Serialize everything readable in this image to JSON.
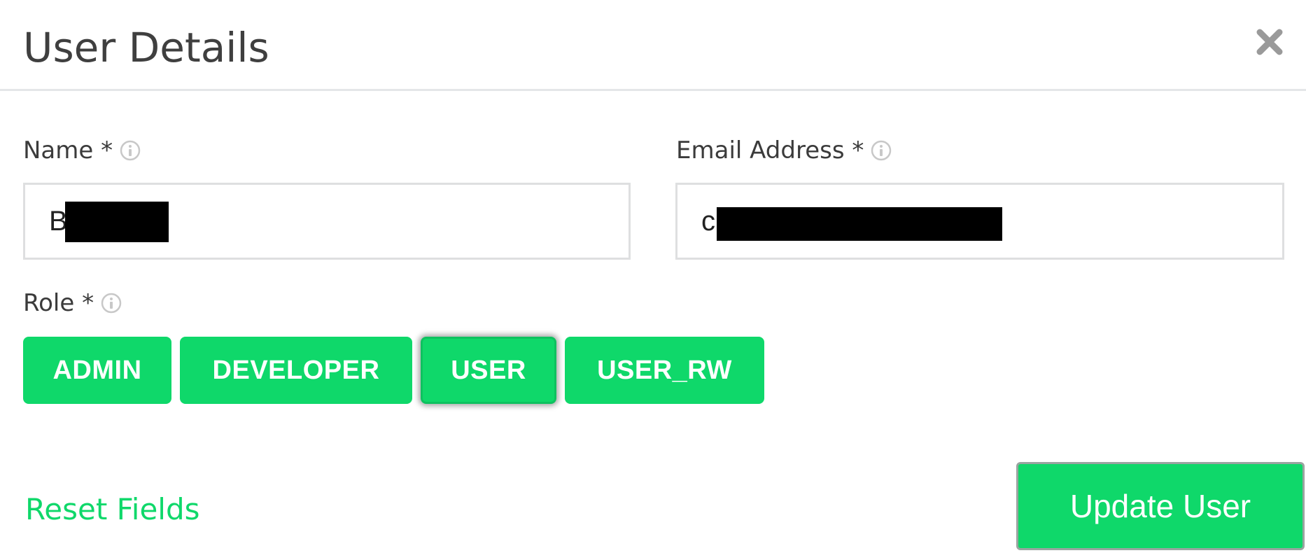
{
  "dialog": {
    "title": "User Details",
    "close_icon": "close-icon"
  },
  "form": {
    "name": {
      "label": "Name *",
      "value": "B          y",
      "info_icon": "info-icon"
    },
    "email": {
      "label": "Email Address *",
      "value": "c                              l",
      "info_icon": "info-icon"
    },
    "role": {
      "label": "Role *",
      "info_icon": "info-icon",
      "options": [
        "ADMIN",
        "DEVELOPER",
        "USER",
        "USER_RW"
      ],
      "selected": "USER"
    }
  },
  "footer": {
    "reset_label": "Reset Fields",
    "update_label": "Update User"
  },
  "colors": {
    "accent": "#0fd86a",
    "text": "#3d3d3d",
    "border": "#dedfe0",
    "redaction": "#000000"
  }
}
